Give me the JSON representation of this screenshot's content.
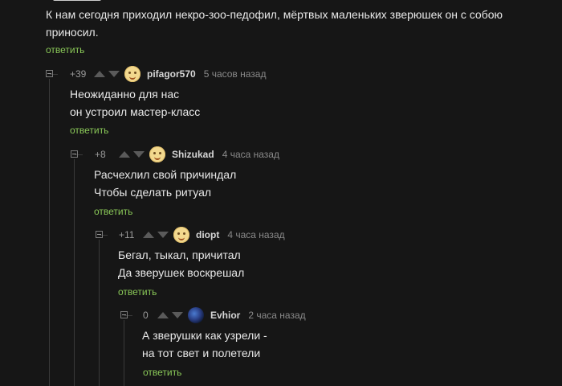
{
  "top_text": {
    "line1": "К нам сегодня приходил некро-зоо-педофил, мёртвых маленьких зверюшек он с собою",
    "line2": "приносил."
  },
  "reply_label": "ответить",
  "comments": [
    {
      "rating": "+39",
      "username": "pifagor570",
      "time": "5 часов назад",
      "avatar": "smiley-face-avatar",
      "lines": [
        "Неожиданно для нас",
        "он устроил мастер-класс"
      ]
    },
    {
      "rating": "+8",
      "username": "Shizukad",
      "time": "4 часа назад",
      "avatar": "smiley-face-avatar",
      "lines": [
        "Расчехлил свой причиндал",
        "Чтобы сделать ритуал"
      ]
    },
    {
      "rating": "+11",
      "username": "diopt",
      "time": "4 часа назад",
      "avatar": "smiley-face-avatar",
      "lines": [
        "Бегал, тыкал, причитал",
        "Да зверушек воскрешал"
      ]
    },
    {
      "rating": "0",
      "username": "Evhior",
      "time": "2 часа назад",
      "avatar": "dark-blue-avatar",
      "lines": [
        "А зверушки как узрели -",
        "на тот свет и полетели"
      ]
    }
  ],
  "colors": {
    "background": "#161616",
    "text": "#e8e8e8",
    "reply_link": "#8ac858",
    "muted": "#8a8a8a",
    "thread_line": "#3a3a3a"
  }
}
